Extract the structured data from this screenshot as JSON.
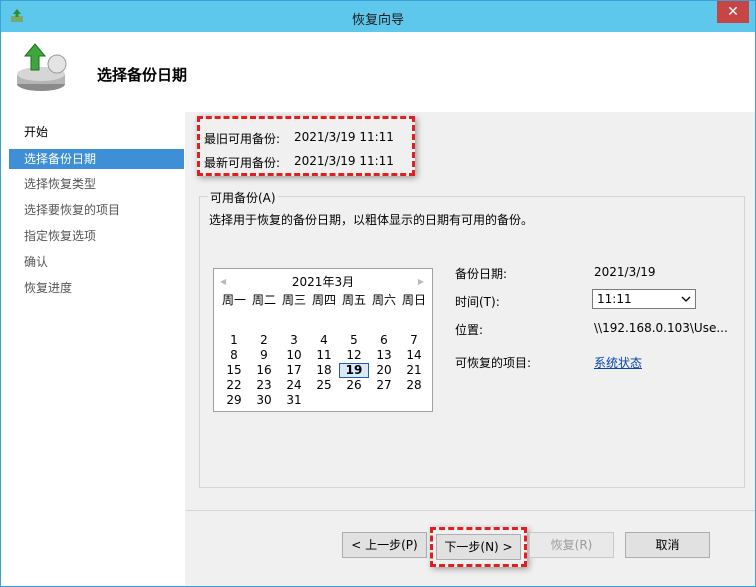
{
  "window": {
    "title": "恢复向导",
    "close_glyph": "✕"
  },
  "header": {
    "page_title": "选择备份日期"
  },
  "sidebar": {
    "items": [
      "开始",
      "选择备份日期",
      "选择恢复类型",
      "选择要恢复的项目",
      "指定恢复选项",
      "确认",
      "恢复进度"
    ],
    "active_index": 1
  },
  "info": {
    "oldest_label": "最旧可用备份:",
    "oldest_value": "2021/3/19 11:11",
    "newest_label": "最新可用备份:",
    "newest_value": "2021/3/19 11:11"
  },
  "group": {
    "legend": "可用备份(A)",
    "description": "选择用于恢复的备份日期，以粗体显示的日期有可用的备份。"
  },
  "calendar": {
    "title": "2021年3月",
    "weekdays": [
      "周一",
      "周二",
      "周三",
      "周四",
      "周五",
      "周六",
      "周日"
    ],
    "days": [
      "",
      "",
      "",
      "",
      "",
      "",
      "",
      "1",
      "2",
      "3",
      "4",
      "5",
      "6",
      "7",
      "8",
      "9",
      "10",
      "11",
      "12",
      "13",
      "14",
      "15",
      "16",
      "17",
      "18",
      "19",
      "20",
      "21",
      "22",
      "23",
      "24",
      "25",
      "26",
      "27",
      "28",
      "29",
      "30",
      "31",
      "",
      "",
      "",
      ""
    ],
    "selected_day": "19",
    "prev_glyph": "◀",
    "next_glyph": "▶"
  },
  "details": {
    "date_label": "备份日期:",
    "date_value": "2021/3/19",
    "time_label": "时间(T):",
    "time_value": "11:11",
    "location_label": "位置:",
    "location_value": "\\\\192.168.0.103\\Use...",
    "items_label": "可恢复的项目:",
    "items_link": "系统状态"
  },
  "buttons": {
    "prev": "< 上一步(P)",
    "next": "下一步(N) >",
    "restore": "恢复(R)",
    "cancel": "取消"
  },
  "colors": {
    "titlebar": "#5ec7ec",
    "selection": "#3e8fd6",
    "highlight_border": "#e02020",
    "link": "#0645ad"
  }
}
